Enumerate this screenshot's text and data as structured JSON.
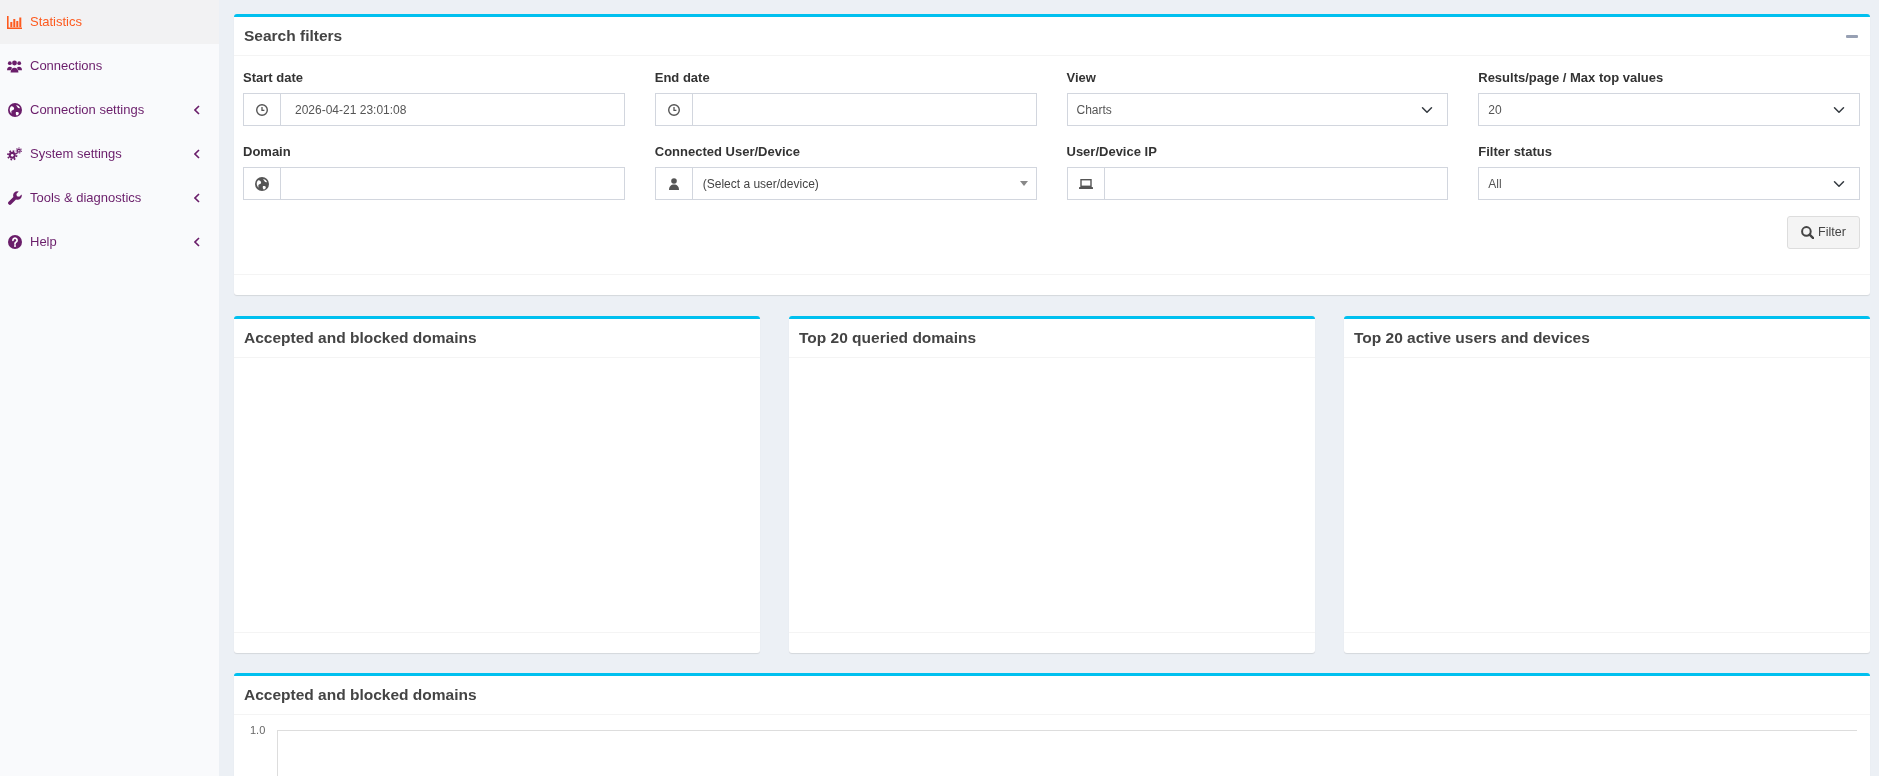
{
  "sidebar": {
    "items": [
      {
        "label": "Statistics",
        "kind": "link",
        "selected": true
      },
      {
        "label": "Connections",
        "kind": "link",
        "selected": false
      },
      {
        "label": "Connection settings",
        "kind": "tree",
        "selected": false,
        "expanded": false
      },
      {
        "label": "System settings",
        "kind": "tree",
        "selected": false,
        "expanded": false
      },
      {
        "label": "Tools & diagnostics",
        "kind": "tree",
        "selected": false,
        "expanded": false
      },
      {
        "label": "Help",
        "kind": "tree",
        "selected": false,
        "expanded": false
      }
    ]
  },
  "search_filters": {
    "title": "Search filters",
    "expanded": true,
    "fields": [
      {
        "label": "Start date",
        "kind": "date",
        "value": "2026-04-21 23:01:08"
      },
      {
        "label": "End date",
        "kind": "date"
      },
      {
        "label": "View",
        "kind": "select",
        "value": "Charts"
      },
      {
        "label": "Results/page / Max top values",
        "kind": "select",
        "value": "20"
      },
      {
        "label": "Domain",
        "kind": "domain"
      },
      {
        "label": "Connected User/Device",
        "kind": "user",
        "placeholder": "(Select a user/device)"
      },
      {
        "label": "User/Device IP",
        "kind": "ip"
      },
      {
        "label": "Filter status",
        "kind": "select",
        "value": "All"
      }
    ],
    "button": "Filter"
  },
  "chart_panels": [
    {
      "title": "Accepted and blocked domains"
    },
    {
      "title": "Top 20 queried domains"
    },
    {
      "title": "Top 20 active users and devices"
    }
  ],
  "timeline_panel": {
    "title": "Accepted and blocked domains",
    "chart": {
      "y_tick_label": "1.0"
    }
  }
}
